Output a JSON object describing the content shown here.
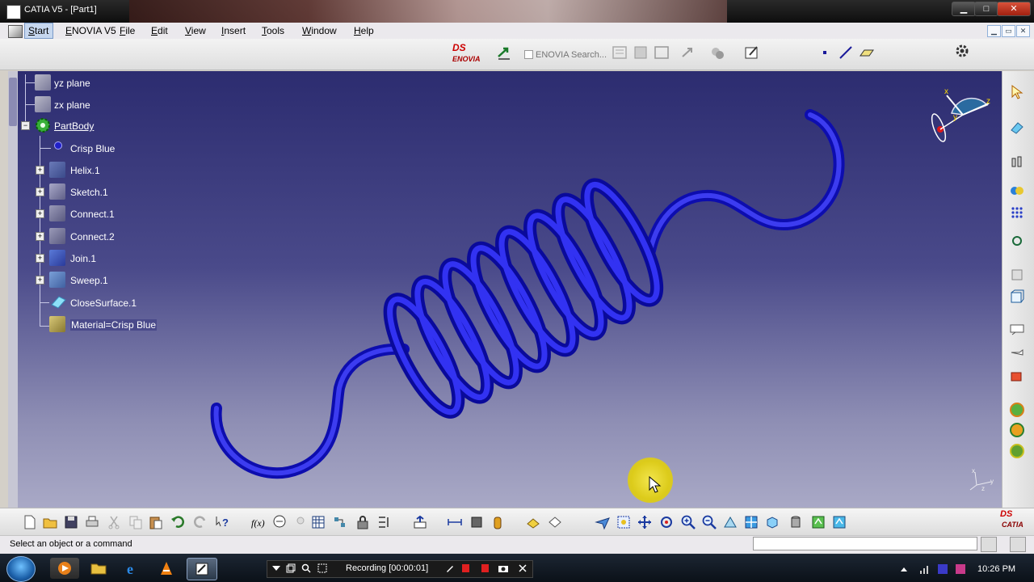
{
  "window": {
    "title": "CATIA V5 - [Part1]",
    "controls": {
      "minimize": "▁",
      "maximize": "□",
      "close": "✕"
    }
  },
  "menu": {
    "items": [
      "Start",
      "ENOVIA V5",
      "File",
      "Edit",
      "View",
      "Insert",
      "Tools",
      "Window",
      "Help"
    ],
    "mdi_controls": [
      "▁",
      "▭",
      "✕"
    ]
  },
  "toolbar_top": {
    "enovia_logo": "ENOVIA",
    "enovia_search_placeholder": "ENOVIA Search..."
  },
  "tree": {
    "items": [
      {
        "label": "yz plane",
        "icon": "plane-icon"
      },
      {
        "label": "zx plane",
        "icon": "plane-icon"
      },
      {
        "label": "PartBody",
        "icon": "part-body-icon",
        "expand": "−"
      },
      {
        "label": "Crisp Blue",
        "icon": "material-dot-icon"
      },
      {
        "label": "Helix.1",
        "icon": "helix-icon",
        "expand": "+"
      },
      {
        "label": "Sketch.1",
        "icon": "sketch-icon",
        "expand": "+"
      },
      {
        "label": "Connect.1",
        "icon": "connect-icon",
        "expand": "+"
      },
      {
        "label": "Connect.2",
        "icon": "connect-icon",
        "expand": "+"
      },
      {
        "label": "Join.1",
        "icon": "join-icon",
        "expand": "+"
      },
      {
        "label": "Sweep.1",
        "icon": "sweep-icon",
        "expand": "+"
      },
      {
        "label": "CloseSurface.1",
        "icon": "close-surface-icon"
      },
      {
        "label": "Material=Crisp Blue",
        "icon": "material-icon"
      }
    ]
  },
  "compass_axes": {
    "x": "x",
    "y": "y",
    "z": "z"
  },
  "triad_axes": {
    "x": "x",
    "y": "y",
    "z": "z"
  },
  "brand": {
    "bottom_logo": "CATIA"
  },
  "status": {
    "message": "Select an object or a command",
    "command_input_value": ""
  },
  "taskbar": {
    "recording_label": "Recording [00:00:01]",
    "clock": "10:26 PM"
  },
  "colors": {
    "spring": "#1c1cd8",
    "viewport_top": "#2c2c70",
    "viewport_bottom": "#a9a9c6",
    "cursor_highlight": "#e5d62c"
  }
}
